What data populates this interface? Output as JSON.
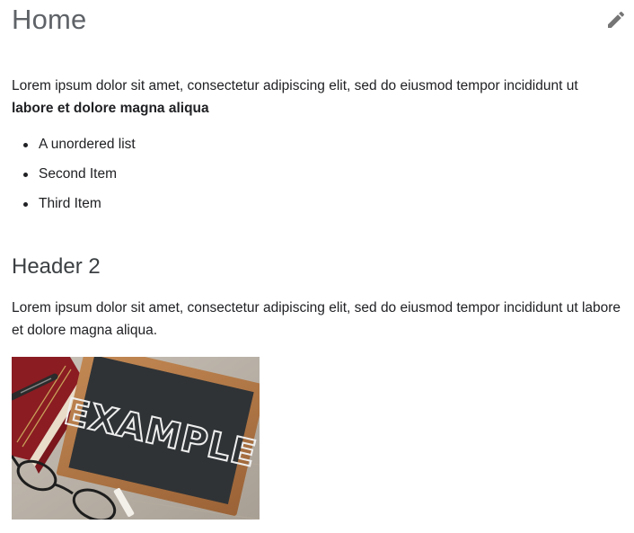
{
  "page": {
    "title": "Home",
    "edit_icon": "pencil-icon"
  },
  "intro": {
    "text": "Lorem ipsum dolor sit amet, consectetur adipiscing elit, sed do eiusmod tempor incididunt ut ",
    "bold_text": "labore et dolore magna aliqua"
  },
  "list": {
    "items": [
      "A unordered list",
      "Second Item",
      "Third Item"
    ]
  },
  "section2": {
    "heading": "Header 2",
    "text": "Lorem ipsum dolor sit amet, consectetur adipiscing elit, sed do eiusmod tempor incididunt ut labore et dolore magna aliqua."
  },
  "image": {
    "chalk_text": "EXAMPLE"
  }
}
